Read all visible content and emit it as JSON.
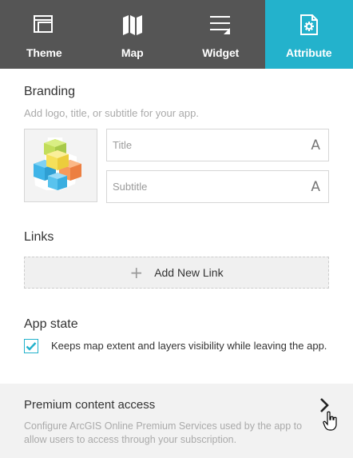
{
  "tabs": [
    {
      "label": "Theme",
      "icon": "theme-icon",
      "active": false
    },
    {
      "label": "Map",
      "icon": "map-icon",
      "active": false
    },
    {
      "label": "Widget",
      "icon": "widget-icon",
      "active": false
    },
    {
      "label": "Attribute",
      "icon": "attribute-icon",
      "active": true
    }
  ],
  "colors": {
    "tab_bar": "#555555",
    "accent": "#23b2cc",
    "hint": "#aaaaaa"
  },
  "branding": {
    "title": "Branding",
    "hint": "Add logo, title, or subtitle for your app.",
    "logo_icon": "app-logo-cubes-icon",
    "title_field": {
      "value": "",
      "placeholder": "Title",
      "font_icon": "A"
    },
    "subtitle_field": {
      "value": "",
      "placeholder": "Subtitle",
      "font_icon": "A"
    }
  },
  "links": {
    "title": "Links",
    "add_icon": "+",
    "add_label": "Add New Link"
  },
  "app_state": {
    "title": "App state",
    "checked": true,
    "checkbox_text": "Keeps map extent and layers visibility while leaving the app."
  },
  "premium": {
    "title": "Premium content access",
    "description": "Configure ArcGIS Online Premium Services used by the app to allow users to access through your subscription.",
    "chevron_icon": "chevron-right-icon"
  }
}
